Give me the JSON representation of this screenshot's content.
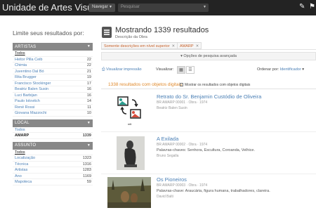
{
  "header": {
    "brand": "Unidade de Artes Visuais",
    "browse_label": "Navegar",
    "search_placeholder": "Pesquisar"
  },
  "sidebar": {
    "title": "Limite seus resultados por:",
    "facets": [
      {
        "heading": "ARTISTAS",
        "items": [
          {
            "label": "Todos",
            "count": ""
          },
          {
            "label": "Heitor Pilla Ceib",
            "count": "22"
          },
          {
            "label": "Chimia",
            "count": "22"
          },
          {
            "label": "Juventino Dal Bó",
            "count": "21"
          },
          {
            "label": "Rita Brugger",
            "count": "19"
          },
          {
            "label": "Francisco Stockinger",
            "count": "17"
          },
          {
            "label": "Beatriz Balen Susin",
            "count": "16"
          },
          {
            "label": "Luci Barbijan",
            "count": "16"
          },
          {
            "label": "Paulo Iolovitch",
            "count": "14"
          },
          {
            "label": "René Rossi",
            "count": "11"
          },
          {
            "label": "Giovana Mazzochi",
            "count": "10"
          }
        ]
      },
      {
        "heading": "LOCAL",
        "items": [
          {
            "label": "Todos",
            "count": ""
          },
          {
            "label": "AMARP",
            "count": "1339"
          }
        ]
      },
      {
        "heading": "ASSUNTO",
        "items": [
          {
            "label": "Todos",
            "count": ""
          },
          {
            "label": "Localização",
            "count": "1323"
          },
          {
            "label": "Técnica",
            "count": "1316"
          },
          {
            "label": "Artistas",
            "count": "1283"
          },
          {
            "label": "Ano",
            "count": "1169"
          },
          {
            "label": "Mapoteca",
            "count": "59"
          }
        ]
      }
    ]
  },
  "main": {
    "title": "Mostrando 1339 resultados",
    "subtitle": "Descrição da Obra",
    "filters": [
      "Somente descrições em nível superior",
      "AMARP"
    ],
    "advanced_search": "Opções de pesquisa avançada",
    "print_preview": "Visualizar impressão",
    "view_label": "Visualizar:",
    "sort_label": "Ordenar por:",
    "sort_value": "Identificador",
    "results_count": "1338 resultados com objetos digitais",
    "digital_objects_check": "Mostrar os resultados com objetos digitais",
    "results": [
      {
        "title": "Retrato do Sr. Benjamin Custódio de Oliveira",
        "ref": "BR AMARP 00001 · Obra · 1974",
        "creator": "Beatriz Balen Susin"
      },
      {
        "title": "A Exilada",
        "ref": "BR AMARP 00002 · Obra · 1974",
        "keywords": "Palavras-chaves: Senhora, Escultura, Coroanda, Velhice.",
        "creator": "Bruno Segalla"
      },
      {
        "title": "Os Pioneiros",
        "ref": "BR AMARP 00003 · Obra · 1974",
        "keywords": "Palavras-chave: Araucária, figura humana, trabalhadores, clareira.",
        "creator": "David Balti"
      }
    ]
  },
  "colors": {
    "topbar": "#232323",
    "link": "#4a7fb5",
    "accent": "#e0892b",
    "facet_header": "#888888"
  }
}
